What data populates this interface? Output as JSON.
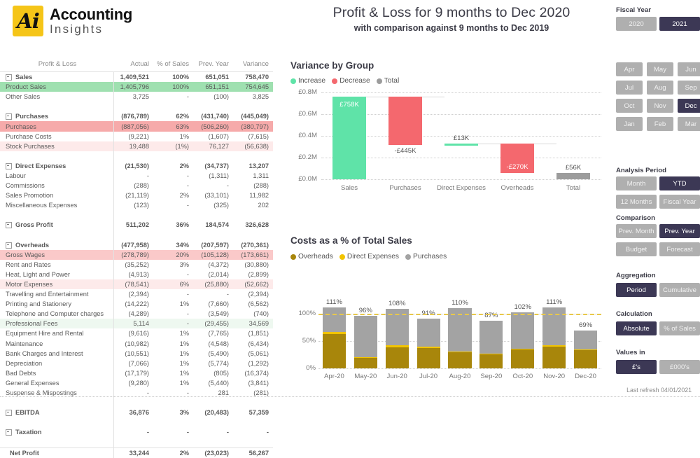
{
  "brand": {
    "mark": "Ai",
    "line1": "Accounting",
    "line2": "Insights"
  },
  "header": {
    "title": "Profit & Loss for 9 months to Dec 2020",
    "subtitle": "with comparison against 9 months to Dec 2019"
  },
  "table": {
    "columns": [
      "Profit & Loss",
      "Actual",
      "% of Sales",
      "Prev. Year",
      "Variance"
    ],
    "rows": [
      {
        "label": "Sales",
        "type": "group",
        "values": [
          "1,409,521",
          "100%",
          "651,051",
          "758,470"
        ],
        "highlight": "none"
      },
      {
        "label": "Product Sales",
        "type": "child",
        "values": [
          "1,405,796",
          "100%",
          "651,151",
          "754,645"
        ],
        "highlight": "hl-green"
      },
      {
        "label": "Other Sales",
        "type": "child",
        "values": [
          "3,725",
          "-",
          "(100)",
          "3,825"
        ],
        "highlight": "none"
      },
      {
        "label": "",
        "type": "spacer",
        "values": [
          "",
          "",
          "",
          ""
        ],
        "highlight": "none"
      },
      {
        "label": "Purchases",
        "type": "group",
        "values": [
          "(876,789)",
          "62%",
          "(431,740)",
          "(445,049)"
        ],
        "highlight": "none"
      },
      {
        "label": "Purchases",
        "type": "child",
        "values": [
          "(887,056)",
          "63%",
          "(506,260)",
          "(380,797)"
        ],
        "highlight": "hl-red3"
      },
      {
        "label": "Purchase Costs",
        "type": "child",
        "values": [
          "(9,221)",
          "1%",
          "(1,607)",
          "(7,615)"
        ],
        "highlight": "none"
      },
      {
        "label": "Stock Purchases",
        "type": "child",
        "values": [
          "19,488",
          "(1%)",
          "76,127",
          "(56,638)"
        ],
        "highlight": "hl-red05"
      },
      {
        "label": "",
        "type": "spacer",
        "values": [
          "",
          "",
          "",
          ""
        ],
        "highlight": "none"
      },
      {
        "label": "Direct Expenses",
        "type": "group",
        "values": [
          "(21,530)",
          "2%",
          "(34,737)",
          "13,207"
        ],
        "highlight": "none"
      },
      {
        "label": "Labour",
        "type": "child",
        "values": [
          "-",
          "-",
          "(1,311)",
          "1,311"
        ],
        "highlight": "none"
      },
      {
        "label": "Commissions",
        "type": "child",
        "values": [
          "(288)",
          "-",
          "-",
          "(288)"
        ],
        "highlight": "none"
      },
      {
        "label": "Sales Promotion",
        "type": "child",
        "values": [
          "(21,119)",
          "2%",
          "(33,101)",
          "11,982"
        ],
        "highlight": "none"
      },
      {
        "label": "Miscellaneous Expenses",
        "type": "child",
        "values": [
          "(123)",
          "-",
          "(325)",
          "202"
        ],
        "highlight": "none"
      },
      {
        "label": "",
        "type": "spacer",
        "values": [
          "",
          "",
          "",
          ""
        ],
        "highlight": "none"
      },
      {
        "label": "Gross Profit",
        "type": "group",
        "values": [
          "511,202",
          "36%",
          "184,574",
          "326,628"
        ],
        "highlight": "none"
      },
      {
        "label": "",
        "type": "spacer",
        "values": [
          "",
          "",
          "",
          ""
        ],
        "highlight": "none"
      },
      {
        "label": "Overheads",
        "type": "group",
        "values": [
          "(477,958)",
          "34%",
          "(207,597)",
          "(270,361)"
        ],
        "highlight": "none"
      },
      {
        "label": "Gross Wages",
        "type": "child",
        "values": [
          "(278,789)",
          "20%",
          "(105,128)",
          "(173,661)"
        ],
        "highlight": "hl-red2"
      },
      {
        "label": "Rent and Rates",
        "type": "child",
        "values": [
          "(35,252)",
          "3%",
          "(4,372)",
          "(30,880)"
        ],
        "highlight": "none"
      },
      {
        "label": "Heat, Light and Power",
        "type": "child",
        "values": [
          "(4,913)",
          "-",
          "(2,014)",
          "(2,899)"
        ],
        "highlight": "none"
      },
      {
        "label": "Motor Expenses",
        "type": "child",
        "values": [
          "(78,541)",
          "6%",
          "(25,880)",
          "(52,662)"
        ],
        "highlight": "hl-red05"
      },
      {
        "label": "Travelling and Entertainment",
        "type": "child",
        "values": [
          "(2,394)",
          "-",
          "-",
          "(2,394)"
        ],
        "highlight": "none"
      },
      {
        "label": "Printing and Stationery",
        "type": "child",
        "values": [
          "(14,222)",
          "1%",
          "(7,660)",
          "(6,562)"
        ],
        "highlight": "none"
      },
      {
        "label": "Telephone and Computer charges",
        "type": "child",
        "values": [
          "(4,289)",
          "-",
          "(3,549)",
          "(740)"
        ],
        "highlight": "none"
      },
      {
        "label": "Professional Fees",
        "type": "child",
        "values": [
          "5,114",
          "-",
          "(29,455)",
          "34,569"
        ],
        "highlight": "hl-grn05"
      },
      {
        "label": "Equipment Hire and Rental",
        "type": "child",
        "values": [
          "(9,616)",
          "1%",
          "(7,765)",
          "(1,851)"
        ],
        "highlight": "none"
      },
      {
        "label": "Maintenance",
        "type": "child",
        "values": [
          "(10,982)",
          "1%",
          "(4,548)",
          "(6,434)"
        ],
        "highlight": "none"
      },
      {
        "label": "Bank Charges and Interest",
        "type": "child",
        "values": [
          "(10,551)",
          "1%",
          "(5,490)",
          "(5,061)"
        ],
        "highlight": "none"
      },
      {
        "label": "Depreciation",
        "type": "child",
        "values": [
          "(7,066)",
          "1%",
          "(5,774)",
          "(1,292)"
        ],
        "highlight": "none"
      },
      {
        "label": "Bad Debts",
        "type": "child",
        "values": [
          "(17,179)",
          "1%",
          "(805)",
          "(16,374)"
        ],
        "highlight": "none"
      },
      {
        "label": "General Expenses",
        "type": "child",
        "values": [
          "(9,280)",
          "1%",
          "(5,440)",
          "(3,841)"
        ],
        "highlight": "none"
      },
      {
        "label": "Suspense & Mispostings",
        "type": "child",
        "values": [
          "-",
          "-",
          "281",
          "(281)"
        ],
        "highlight": "none"
      },
      {
        "label": "",
        "type": "spacer",
        "values": [
          "",
          "",
          "",
          ""
        ],
        "highlight": "none"
      },
      {
        "label": "EBITDA",
        "type": "group",
        "values": [
          "36,876",
          "3%",
          "(20,483)",
          "57,359"
        ],
        "highlight": "none"
      },
      {
        "label": "",
        "type": "spacer",
        "values": [
          "",
          "",
          "",
          ""
        ],
        "highlight": "none"
      },
      {
        "label": "Taxation",
        "type": "group",
        "values": [
          "-",
          "-",
          "-",
          "-"
        ],
        "highlight": "none"
      },
      {
        "label": "",
        "type": "spacer",
        "values": [
          "",
          "",
          "",
          ""
        ],
        "highlight": "none"
      },
      {
        "label": "Net Profit",
        "type": "total",
        "values": [
          "33,244",
          "2%",
          "(23,023)",
          "56,267"
        ],
        "highlight": "none"
      }
    ]
  },
  "chart_data": [
    {
      "type": "bar",
      "subtype": "waterfall",
      "title": "Variance by Group",
      "xlabel": "",
      "ylabel": "",
      "ylim": [
        0,
        0.8
      ],
      "ytick_labels": [
        "£0.0M",
        "£0.2M",
        "£0.4M",
        "£0.6M",
        "£0.8M"
      ],
      "ytick_values": [
        0,
        0.2,
        0.4,
        0.6,
        0.8
      ],
      "grid": true,
      "legend_position": "top-left",
      "legend": [
        {
          "name": "Increase",
          "color": "#5FE3A8"
        },
        {
          "name": "Decrease",
          "color": "#F4686E"
        },
        {
          "name": "Total",
          "color": "#9C9C9C"
        }
      ],
      "categories": [
        "Sales",
        "Purchases",
        "Direct Expenses",
        "Overheads",
        "Total"
      ],
      "data_labels": [
        "£758K",
        "-£445K",
        "£13K",
        "-£270K",
        "£56K"
      ],
      "values": [
        758470,
        -445049,
        13207,
        -270361,
        56267
      ],
      "bar_kinds": [
        "increase",
        "decrease",
        "increase",
        "decrease",
        "total"
      ],
      "bar_base": [
        0,
        313421,
        313421,
        56267,
        0
      ],
      "bar_top": [
        758470,
        758470,
        326628,
        326628,
        56267
      ]
    },
    {
      "type": "bar",
      "subtype": "stacked-column",
      "title": "Costs as a % of Total Sales",
      "xlabel": "",
      "ylabel": "",
      "ylim": [
        0,
        120
      ],
      "ytick_labels": [
        "0%",
        "50%",
        "100%"
      ],
      "ytick_values": [
        0,
        50,
        100
      ],
      "grid": true,
      "reference_line": {
        "value": 100,
        "color": "#E8C84A",
        "style": "dashed"
      },
      "legend_position": "top-left",
      "legend": [
        {
          "name": "Overheads",
          "color": "#A8860B"
        },
        {
          "name": "Direct Expenses",
          "color": "#F2C400"
        },
        {
          "name": "Purchases",
          "color": "#A3A3A3"
        }
      ],
      "categories": [
        "Apr-20",
        "May-20",
        "Jun-20",
        "Jul-20",
        "Aug-20",
        "Sep-20",
        "Oct-20",
        "Nov-20",
        "Dec-20"
      ],
      "totals_labels": [
        "111%",
        "96%",
        "108%",
        "91%",
        "110%",
        "87%",
        "102%",
        "111%",
        "69%"
      ],
      "totals": [
        111,
        96,
        108,
        91,
        110,
        87,
        102,
        111,
        69
      ],
      "series": [
        {
          "name": "Overheads",
          "values": [
            62,
            19,
            38,
            37,
            30,
            25,
            35,
            39,
            33
          ]
        },
        {
          "name": "Direct Expenses",
          "values": [
            4,
            2,
            4,
            2,
            1,
            2,
            1,
            3,
            2
          ]
        },
        {
          "name": "Purchases",
          "values": [
            45,
            75,
            66,
            52,
            79,
            60,
            66,
            69,
            34
          ]
        }
      ]
    }
  ],
  "slicers": {
    "fiscal_year": {
      "title": "Fiscal Year",
      "options": [
        "2020",
        "2021"
      ],
      "selected": "2021"
    },
    "months": {
      "options": [
        "Apr",
        "May",
        "Jun",
        "Jul",
        "Aug",
        "Sep",
        "Oct",
        "Nov",
        "Dec",
        "Jan",
        "Feb",
        "Mar"
      ],
      "selected": "Dec"
    },
    "analysis_period": {
      "title": "Analysis Period",
      "options": [
        "Month",
        "YTD",
        "12 Months",
        "Fiscal Year"
      ],
      "selected": "YTD"
    },
    "comparison": {
      "title": "Comparison",
      "options": [
        "Prev. Month",
        "Prev. Year",
        "Budget",
        "Forecast"
      ],
      "selected": "Prev. Year"
    },
    "aggregation": {
      "title": "Aggregation",
      "options": [
        "Period",
        "Cumulative"
      ],
      "selected": "Period"
    },
    "calculation": {
      "title": "Calculation",
      "options": [
        "Absolute",
        "% of Sales"
      ],
      "selected": "Absolute"
    },
    "values_in": {
      "title": "Values in",
      "options": [
        "£'s",
        "£000's"
      ],
      "selected": "£'s"
    }
  },
  "footer": {
    "last_refresh": "Last refresh 04/01/2021"
  }
}
